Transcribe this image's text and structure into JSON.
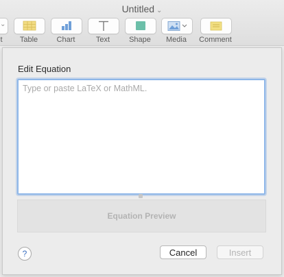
{
  "window": {
    "title": "Untitled"
  },
  "toolbar": {
    "items": [
      {
        "label": "t",
        "icon": "insert-icon"
      },
      {
        "label": "Table",
        "icon": "table-icon"
      },
      {
        "label": "Chart",
        "icon": "chart-icon"
      },
      {
        "label": "Text",
        "icon": "text-icon"
      },
      {
        "label": "Shape",
        "icon": "shape-icon"
      },
      {
        "label": "Media",
        "icon": "media-icon"
      },
      {
        "label": "Comment",
        "icon": "comment-icon"
      }
    ]
  },
  "dialog": {
    "title": "Edit Equation",
    "editor": {
      "value": "",
      "placeholder": "Type or paste LaTeX or MathML."
    },
    "preview_label": "Equation Preview",
    "help_label": "?",
    "cancel_label": "Cancel",
    "insert_label": "Insert"
  },
  "colors": {
    "focus_ring": "#8db6e8",
    "table_icon": "#f2dc84",
    "chart_icon": "#6f9fd8",
    "shape_icon": "#6cbfa9",
    "comment_icon": "#f2df83"
  }
}
